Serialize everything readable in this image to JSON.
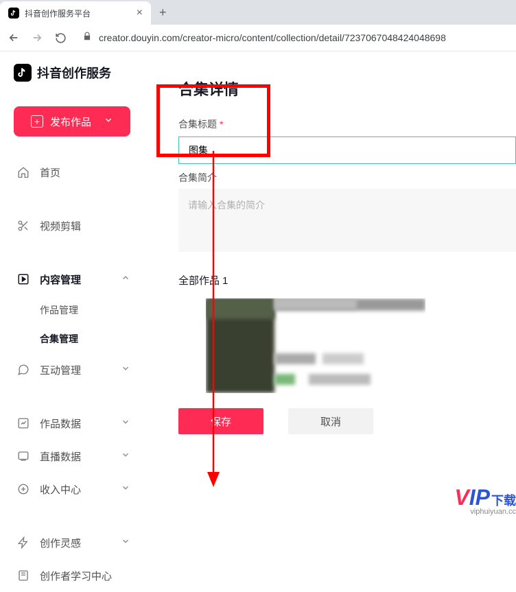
{
  "browser": {
    "tab_title": "抖音创作服务平台",
    "url": "creator.douyin.com/creator-micro/content/collection/detail/7237067048424048698"
  },
  "sidebar": {
    "logo_text": "抖音创作服务",
    "publish_label": "发布作品",
    "items": [
      {
        "label": "首页",
        "icon": "home"
      },
      {
        "label": "视频剪辑",
        "icon": "scissors"
      },
      {
        "label": "内容管理",
        "icon": "play-square",
        "active": true,
        "expanded": true
      },
      {
        "label": "互动管理",
        "icon": "chat"
      },
      {
        "label": "作品数据",
        "icon": "chart"
      },
      {
        "label": "直播数据",
        "icon": "live"
      },
      {
        "label": "收入中心",
        "icon": "plus-circle"
      },
      {
        "label": "创作灵感",
        "icon": "flash"
      },
      {
        "label": "创作者学习中心",
        "icon": "book"
      }
    ],
    "sub_items": [
      {
        "label": "作品管理"
      },
      {
        "label": "合集管理",
        "active": true
      }
    ]
  },
  "main": {
    "page_title": "合集详情",
    "title_field_label": "合集标题",
    "title_value": "图集",
    "desc_field_label": "合集简介",
    "desc_placeholder": "请输入合集的简介",
    "works_label": "全部作品",
    "works_count": "1",
    "save_label": "保存",
    "cancel_label": "取消"
  },
  "watermark": {
    "brand": "VIP下载",
    "url": "viphuiyuan.cc"
  }
}
